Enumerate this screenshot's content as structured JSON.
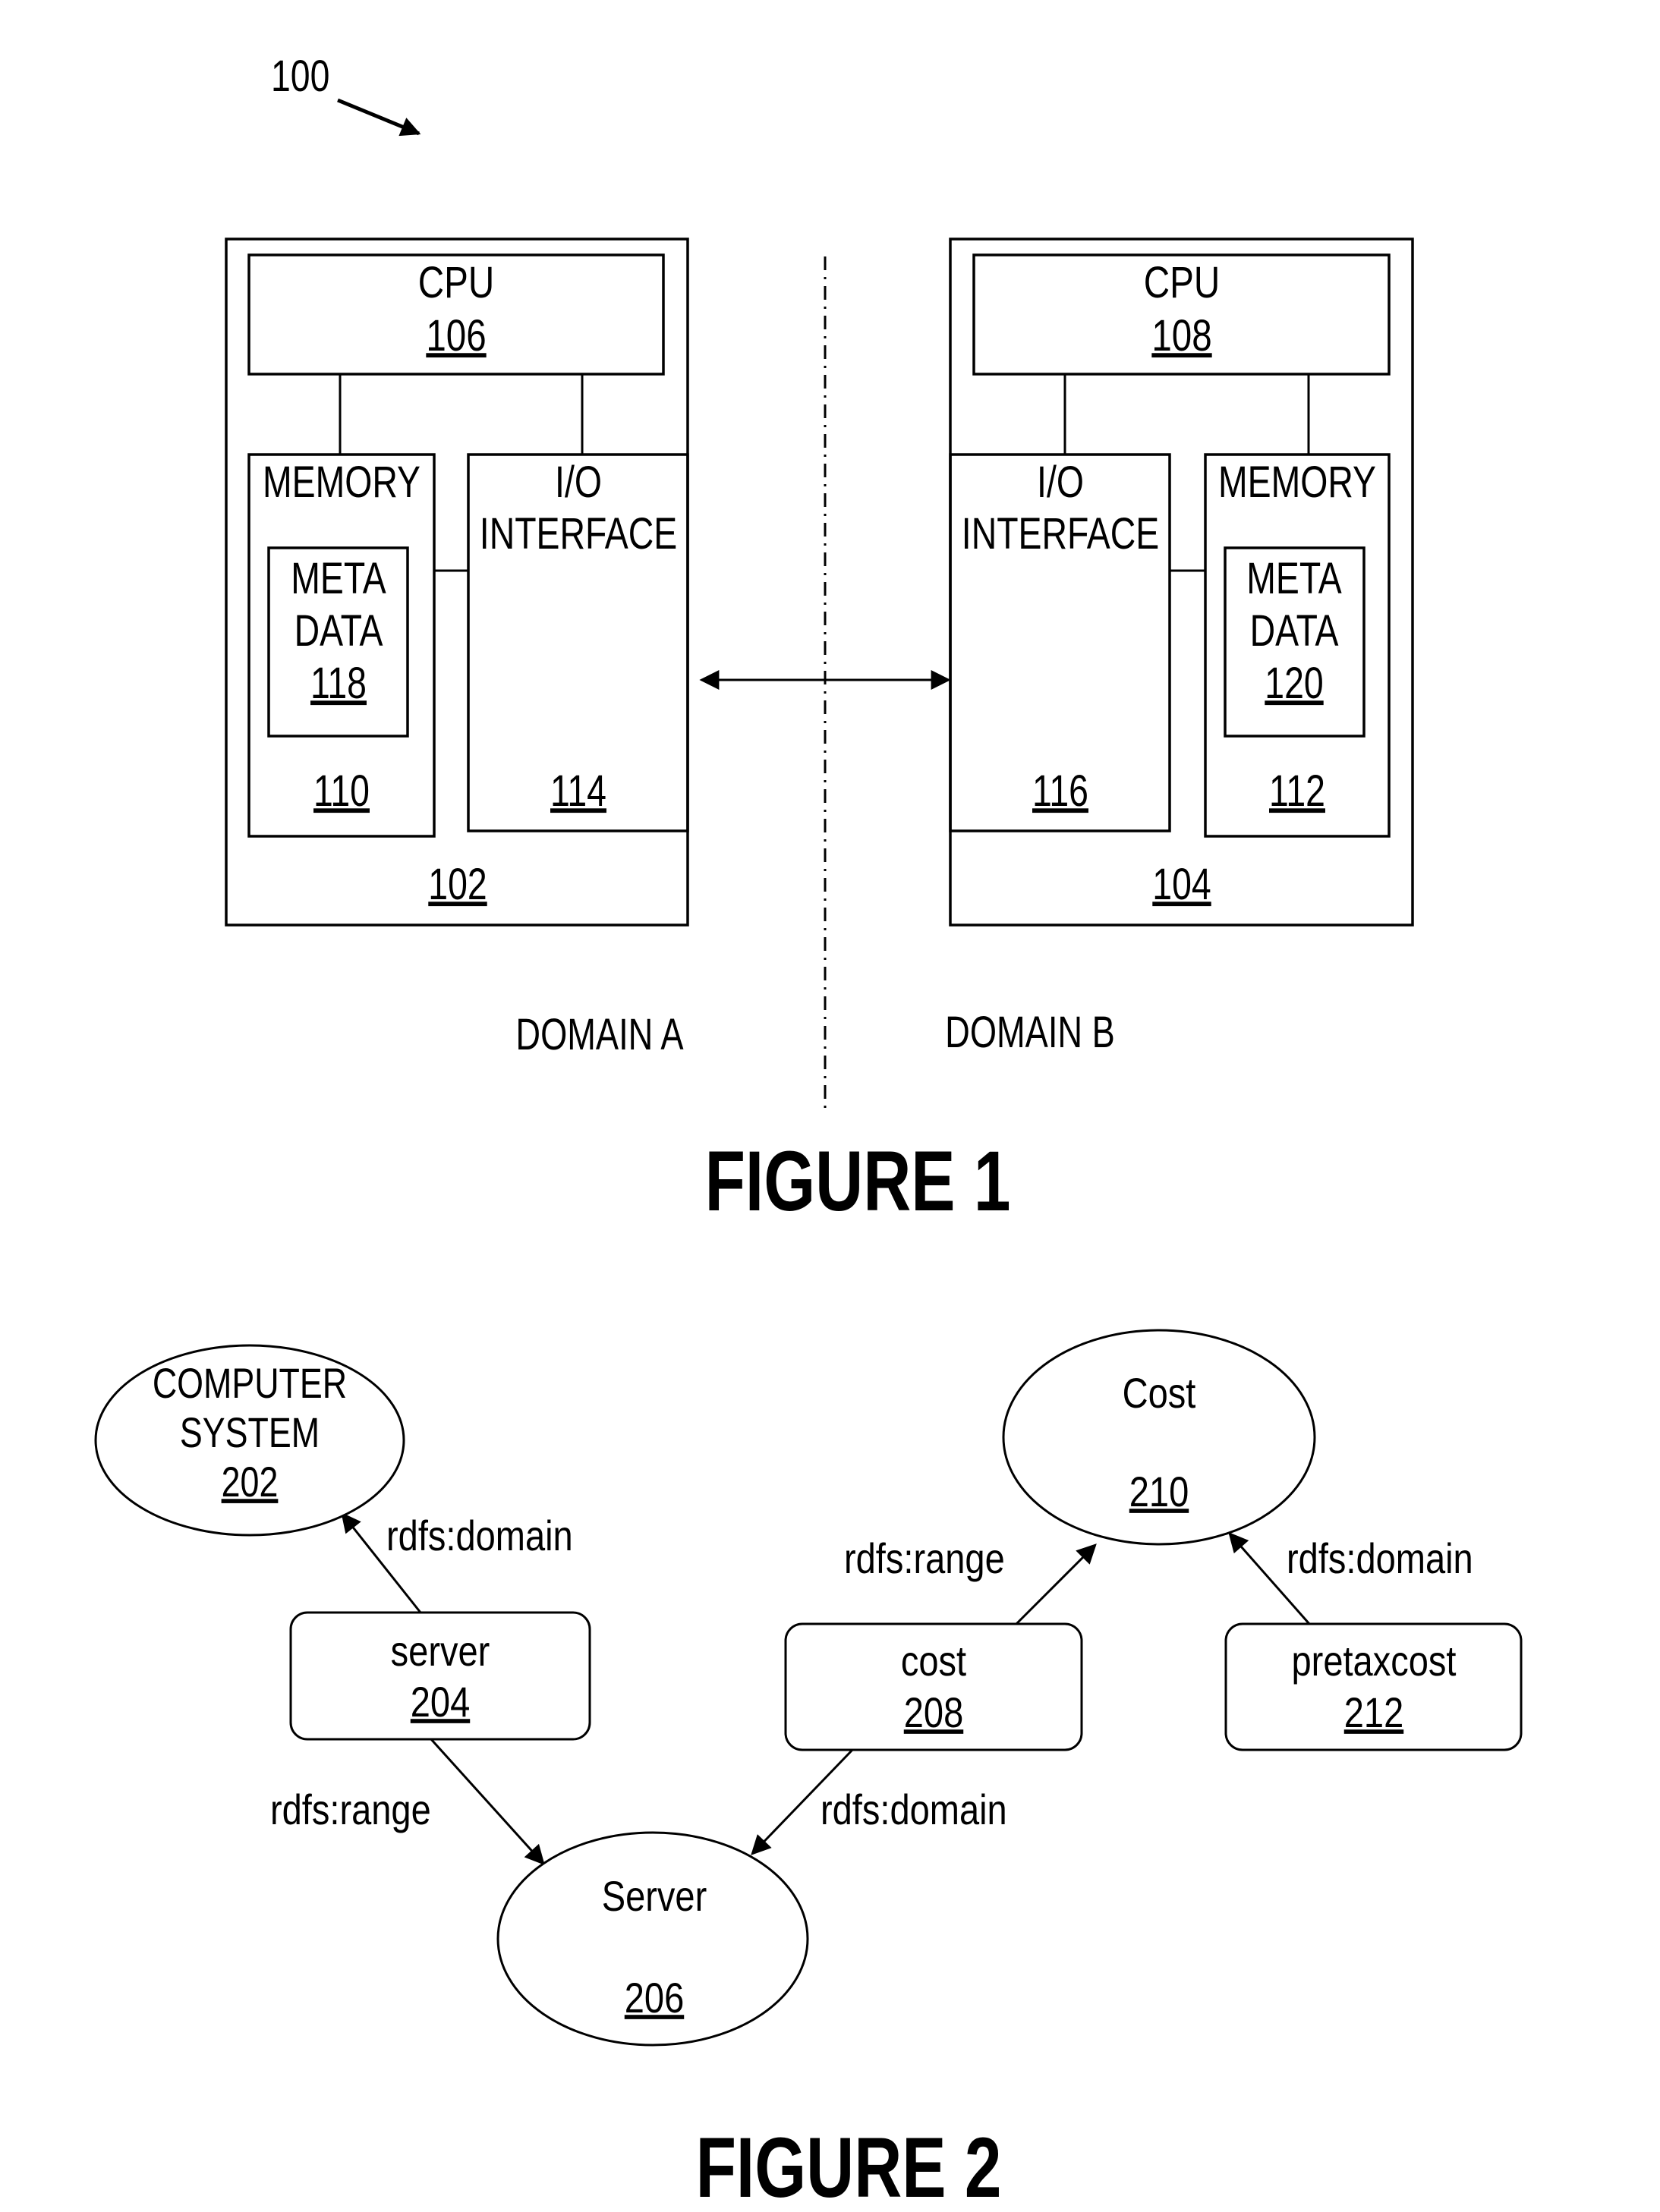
{
  "figure1": {
    "title": "FIGURE 1",
    "system_ref": "100",
    "domain_a_label": "DOMAIN A",
    "domain_b_label": "DOMAIN B",
    "computer_a": {
      "ref": "102",
      "cpu": {
        "label": "CPU",
        "ref": "106"
      },
      "memory": {
        "label": "MEMORY",
        "ref": "110"
      },
      "metadata": {
        "label_line1": "META",
        "label_line2": "DATA",
        "ref": "118"
      },
      "io": {
        "label_line1": "I/O",
        "label_line2": "INTERFACE",
        "ref": "114"
      }
    },
    "computer_b": {
      "ref": "104",
      "cpu": {
        "label": "CPU",
        "ref": "108"
      },
      "memory": {
        "label": "MEMORY",
        "ref": "112"
      },
      "metadata": {
        "label_line1": "META",
        "label_line2": "DATA",
        "ref": "120"
      },
      "io": {
        "label_line1": "I/O",
        "label_line2": "INTERFACE",
        "ref": "116"
      }
    }
  },
  "figure2": {
    "title": "FIGURE 2",
    "classes": [
      {
        "id": "computer-system",
        "label_lines": [
          "COMPUTER",
          "SYSTEM"
        ],
        "ref": "202"
      },
      {
        "id": "server-class",
        "label_lines": [
          "Server"
        ],
        "ref": "206"
      },
      {
        "id": "cost-class",
        "label_lines": [
          "Cost"
        ],
        "ref": "210"
      }
    ],
    "properties": [
      {
        "id": "server-property",
        "label": "server",
        "ref": "204"
      },
      {
        "id": "cost-property",
        "label": "cost",
        "ref": "208"
      },
      {
        "id": "pretaxcost-property",
        "label": "pretaxcost",
        "ref": "212"
      }
    ],
    "edges": [
      {
        "from": "server-property",
        "to": "computer-system",
        "label": "rdfs:domain"
      },
      {
        "from": "server-property",
        "to": "server-class",
        "label": "rdfs:range"
      },
      {
        "from": "cost-property",
        "to": "server-class",
        "label": "rdfs:domain"
      },
      {
        "from": "cost-property",
        "to": "cost-class",
        "label": "rdfs:range"
      },
      {
        "from": "pretaxcost-property",
        "to": "cost-class",
        "label": "rdfs:domain"
      }
    ]
  }
}
